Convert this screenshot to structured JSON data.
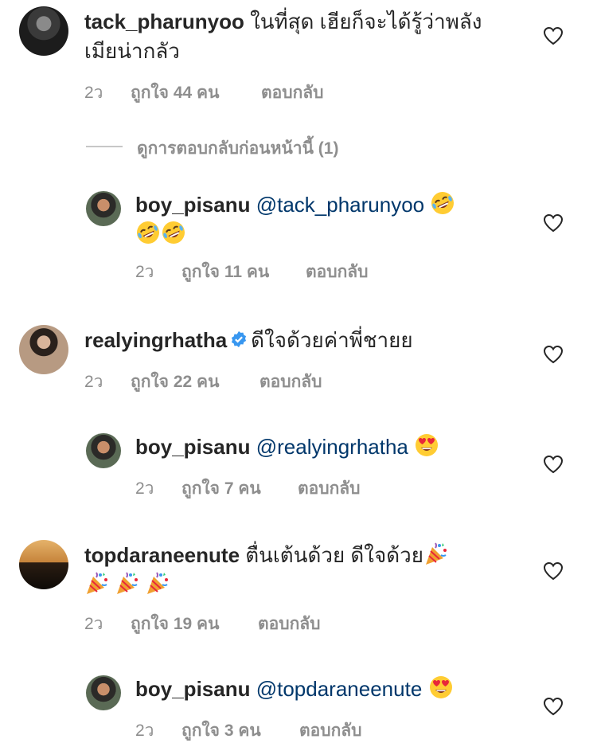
{
  "comments": [
    {
      "username": "tack_pharunyoo",
      "text_line1": "ในที่สุด เฮียก็จะได้รู้ว่าพลัง",
      "text_line2": "เมียน่ากลัว",
      "time": "2ว",
      "likes": "ถูกใจ 44 คน",
      "reply": "ตอบกลับ",
      "view_previous_replies": "ดูการตอบกลับก่อนหน้านี้ (1)"
    },
    {
      "username": "boy_pisanu",
      "mention": "@tack_pharunyoo",
      "emoji": "rolling-on-floor-laughing",
      "time": "2ว",
      "likes": "ถูกใจ 11 คน",
      "reply": "ตอบกลับ"
    },
    {
      "username": "realyingrhatha",
      "verified": true,
      "text": "ดีใจด้วยค่าพี่ชายย",
      "time": "2ว",
      "likes": "ถูกใจ 22 คน",
      "reply": "ตอบกลับ"
    },
    {
      "username": "boy_pisanu",
      "mention": "@realyingrhatha",
      "emoji": "heart-eyes",
      "time": "2ว",
      "likes": "ถูกใจ 7 คน",
      "reply": "ตอบกลับ"
    },
    {
      "username": "topdaraneenute",
      "text": "ตื่นเต้นด้วย ดีใจด้วย",
      "emoji": "party-popper",
      "time": "2ว",
      "likes": "ถูกใจ 19 คน",
      "reply": "ตอบกลับ"
    },
    {
      "username": "boy_pisanu",
      "mention": "@topdaraneenute",
      "emoji": "heart-eyes",
      "time": "2ว",
      "likes": "ถูกใจ 3 คน",
      "reply": "ตอบกลับ"
    }
  ],
  "icons": {
    "like": "heart-outline-icon",
    "verified": "verified-badge-icon"
  },
  "colors": {
    "text": "#262626",
    "meta": "#8e8e8e",
    "mention": "#00376b",
    "verified": "#3897f0"
  }
}
